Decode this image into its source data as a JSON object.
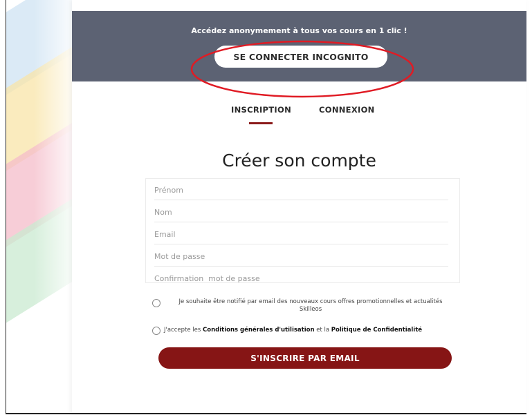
{
  "banner": {
    "tagline": "Accédez anonymement à tous vos cours en 1 clic !",
    "incognito_label": "SE CONNECTER INCOGNITO",
    "annotation_color": "#e01b24"
  },
  "tabs": [
    {
      "label": "INSCRIPTION",
      "active": true
    },
    {
      "label": "CONNEXION",
      "active": false
    }
  ],
  "form": {
    "title": "Créer son compte",
    "fields": [
      {
        "placeholder": "Prénom",
        "value": ""
      },
      {
        "placeholder": "Nom",
        "value": ""
      },
      {
        "placeholder": "Email",
        "value": ""
      },
      {
        "placeholder": "Mot de passe",
        "value": ""
      },
      {
        "placeholder": "Confirmation  mot de passe",
        "value": ""
      }
    ],
    "newsletter_text": "Je souhaite être notifié par email des nouveaux cours offres promotionnelles et actualités Skilleos",
    "terms": {
      "prefix": "J'accepte les ",
      "cgu": "Conditions générales d'utilisation",
      "middle": " et la ",
      "privacy": "Politique de Confidentialité"
    },
    "submit_label": "S'INSCRIRE PAR EMAIL"
  },
  "colors": {
    "banner_bg": "#5c6273",
    "accent": "#861515",
    "stripes": [
      "#cfe3f3",
      "#f8e4a8",
      "#f4bcc9",
      "#c9ead0"
    ]
  }
}
